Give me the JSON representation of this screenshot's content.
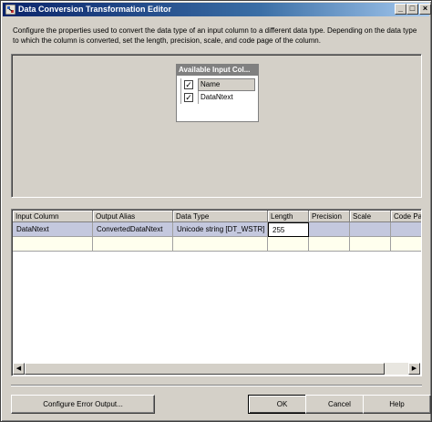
{
  "window": {
    "title": "Data Conversion Transformation Editor",
    "description": "Configure the properties used to convert the data type of an input column to a different data type. Depending on the data type to which the column is converted, set the length, precision, scale, and code page of the column."
  },
  "available_columns": {
    "header": "Available Input Col...",
    "name_header": "Name",
    "columns": [
      {
        "name": "DataNtext",
        "checked": true
      }
    ]
  },
  "grid": {
    "headers": [
      "Input Column",
      "Output Alias",
      "Data Type",
      "Length",
      "Precision",
      "Scale",
      "Code Page"
    ],
    "rows": [
      {
        "input_column": "DataNtext",
        "output_alias": "ConvertedDataNtext",
        "data_type": "Unicode string [DT_WSTR]",
        "length": "255",
        "precision": "",
        "scale": "",
        "code_page": ""
      }
    ]
  },
  "buttons": {
    "configure_error": "Configure Error Output...",
    "ok": "OK",
    "cancel": "Cancel",
    "help": "Help"
  },
  "icons": {
    "minimize": "minimize-icon",
    "maximize": "maximize-icon",
    "close": "close-icon"
  }
}
